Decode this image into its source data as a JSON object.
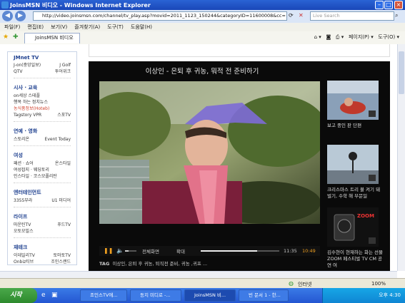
{
  "window": {
    "title": "JoinsMSN 비디오 - Windows Internet Explorer"
  },
  "address": {
    "url": "http://video.joinsmsn.com/channel/tv_play.asp?movid=2011_1123_150244&categoryID=11600008&cc=",
    "search_placeholder": "Live Search"
  },
  "menu": [
    "파일(F)",
    "편집(E)",
    "보기(V)",
    "즐겨찾기(A)",
    "도구(T)",
    "도움말(H)"
  ],
  "tab": {
    "label": "JoinsMSN 비디오"
  },
  "tools": {
    "page": "페이지(P)",
    "tools": "도구(O)"
  },
  "sidebar": {
    "jtv": {
      "title": "JMnet TV",
      "rows": [
        [
          "J-on(중앙일보)",
          "J Golf"
        ],
        [
          "QTV",
          "투어위크"
        ]
      ]
    },
    "news": {
      "title": "시사 · 교육",
      "rows": [
        [
          "on세상 스테플"
        ],
        [
          "행복 하는 정치뉴스"
        ],
        [
          "농식품정보(Hoteb)"
        ],
        [
          "Tagstory VPR",
          "스포TV"
        ]
      ]
    },
    "ent": {
      "title": "연예 · 영화",
      "rows": [
        [
          "스토리온",
          "Event Today"
        ]
      ]
    },
    "women": {
      "title": "여성",
      "rows": [
        [
          "패션 · 쇼어",
          "온스타일"
        ],
        [
          "여성잡지 · 웨딩토리"
        ],
        [
          "인스타일 · 코스모폴리탄"
        ]
      ]
    },
    "entertainment": {
      "title": "엔터테인먼트",
      "rows": [
        [
          "3355부라",
          "U1 미디어"
        ]
      ]
    },
    "life": {
      "title": "라이프",
      "rows": [
        [
          "마운틴TV",
          "푸드TV"
        ],
        [
          "오토모빌스"
        ]
      ]
    },
    "finance": {
      "title": "재테크",
      "rows": [
        [
          "이데일리TV",
          "토마토TV"
        ],
        [
          "Onbiz티브",
          "조인스랜드"
        ]
      ]
    }
  },
  "player": {
    "title": "이상인 - 은퇴 후 귀농, 뭐적 전 준비하기",
    "controls": {
      "fullscreen": "전체화면",
      "enlarge": "확대",
      "time_current": "11:35",
      "time_total": "10:49"
    },
    "tag_label": "TAG",
    "tags": "이상인, 은퇴 후 귀농, 퇴직전 준비, 귀농 ,귀프 ...",
    "progress": 0.72,
    "volume": 0.3
  },
  "thumbnails": [
    {
      "caption": "보고 중인 판 단편"
    },
    {
      "caption": "크리스마스 트리 불 켜기 돼 벌기, 수학 해 부문일"
    },
    {
      "caption": "김수현이 현재하는 화는 선물 ZOOM 페스티벌 TV CM 공연 여",
      "badge": "ZOOM"
    }
  ],
  "status": {
    "text": "인터넷",
    "zoom": "100%"
  },
  "taskbar": {
    "start": "시작",
    "tasks": [
      "조인스TV에...",
      "동지 미디로 -...",
      "JoinsMSN 비...",
      "빈 문서 1 - 한..."
    ],
    "time": "오후 4:30"
  }
}
